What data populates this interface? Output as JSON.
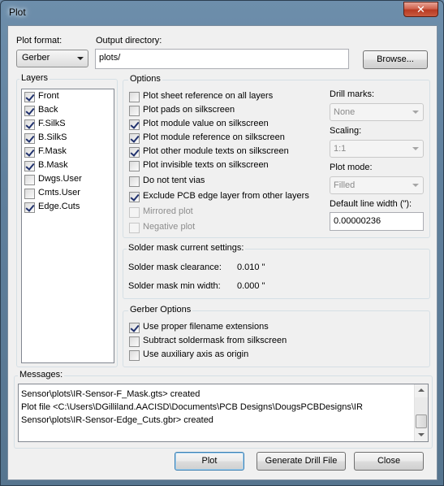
{
  "window": {
    "title": "Plot",
    "close_glyph": "✕"
  },
  "plot_format": {
    "label": "Plot format:",
    "value": "Gerber"
  },
  "output_dir": {
    "label": "Output directory:",
    "value": "plots/",
    "browse_label": "Browse..."
  },
  "layers": {
    "title": "Layers",
    "items": [
      {
        "label": "Front",
        "checked": true
      },
      {
        "label": "Back",
        "checked": true
      },
      {
        "label": "F.SilkS",
        "checked": true
      },
      {
        "label": "B.SilkS",
        "checked": true
      },
      {
        "label": "F.Mask",
        "checked": true
      },
      {
        "label": "B.Mask",
        "checked": true
      },
      {
        "label": "Dwgs.User",
        "checked": false
      },
      {
        "label": "Cmts.User",
        "checked": false
      },
      {
        "label": "Edge.Cuts",
        "checked": true
      }
    ]
  },
  "options": {
    "title": "Options",
    "items": [
      {
        "label": "Plot sheet reference on all layers",
        "checked": false,
        "disabled": false
      },
      {
        "label": "Plot pads on silkscreen",
        "checked": false,
        "disabled": false
      },
      {
        "label": "Plot module value on silkscreen",
        "checked": true,
        "disabled": false
      },
      {
        "label": "Plot module reference on silkscreen",
        "checked": true,
        "disabled": false
      },
      {
        "label": "Plot other module texts on silkscreen",
        "checked": true,
        "disabled": false
      },
      {
        "label": "Plot invisible texts on silkscreen",
        "checked": false,
        "disabled": false
      },
      {
        "label": "Do not tent vias",
        "checked": false,
        "disabled": false
      },
      {
        "label": "Exclude PCB edge layer from other layers",
        "checked": true,
        "disabled": false
      },
      {
        "label": "Mirrored plot",
        "checked": false,
        "disabled": true
      },
      {
        "label": "Negative plot",
        "checked": false,
        "disabled": true
      }
    ],
    "drill_marks": {
      "label": "Drill marks:",
      "value": "None"
    },
    "scaling": {
      "label": "Scaling:",
      "value": "1:1"
    },
    "plot_mode": {
      "label": "Plot mode:",
      "value": "Filled"
    },
    "line_width": {
      "label": "Default line width (\"):",
      "value": "0.00000236"
    }
  },
  "solder_mask": {
    "title": "Solder mask current settings:",
    "clearance_label": "Solder mask clearance:",
    "clearance_value": "0.010 \"",
    "min_width_label": "Solder mask min width:",
    "min_width_value": "0.000 \""
  },
  "gerber_options": {
    "title": "Gerber Options",
    "items": [
      {
        "label": "Use proper filename extensions",
        "checked": true
      },
      {
        "label": "Subtract soldermask from silkscreen",
        "checked": false
      },
      {
        "label": "Use auxiliary axis as origin",
        "checked": false
      }
    ]
  },
  "messages": {
    "title": "Messages:",
    "lines": [
      "Sensor\\plots\\IR-Sensor-F_Mask.gts> created",
      "Plot file <C:\\Users\\DGilliland.AACISD\\Documents\\PCB Designs\\DougsPCBDesigns\\IR",
      "Sensor\\plots\\IR-Sensor-Edge_Cuts.gbr> created"
    ]
  },
  "buttons": {
    "plot": "Plot",
    "drill": "Generate Drill File",
    "close": "Close"
  },
  "icons": {
    "close": "close-icon",
    "dropdown": "chevron-down-icon",
    "check": "checkmark-icon"
  }
}
